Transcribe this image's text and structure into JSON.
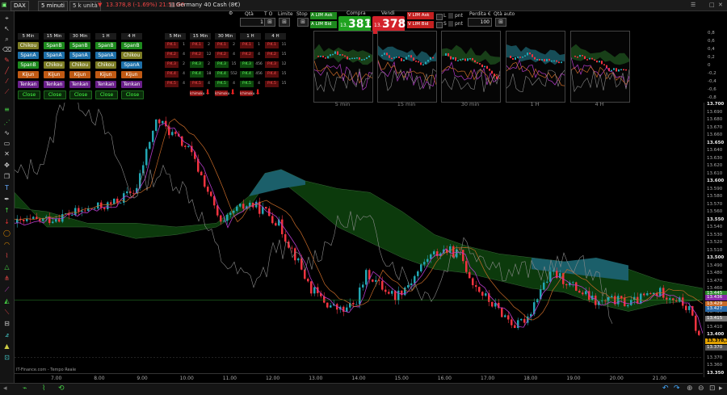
{
  "titlebar": {
    "symbol": "DAX",
    "timeframe": "5 minuti",
    "units": "5 k unità",
    "price_line": "13.378,8 (-1.69%) 21:51:00",
    "instrument": "Germany 40 Cash (8€)"
  },
  "order_panel": {
    "qty_label": "Qtà",
    "qty_value": "1",
    "to_label": "T O",
    "limit_label": "Limite",
    "stop_label": "Stop",
    "buy_label": "Compra",
    "buy_prefix": "13.",
    "buy_big": "381",
    "buy_sup": ",2",
    "sell_label": "Vendi",
    "sell_prefix": "13.",
    "sell_big": "378",
    "sell_sup": ",4",
    "lim_ask_a": "A  LIM Ask",
    "lim_bid_a": "A  LIM Bid",
    "lim_ask_v": "V  LIM Ask",
    "lim_bid_v": "V  LIM Bid",
    "l_label": "L",
    "s_label": "S",
    "pnt_label": "pnt",
    "loss_label": "Perdita €",
    "loss_value": "100",
    "auto_qty": "Qtà auto"
  },
  "ichimoku_grid": {
    "timeframes": [
      "5 Min",
      "15 Min",
      "30 Min",
      "1 H",
      "4 H"
    ],
    "rows": [
      [
        "Chikou",
        "SpanB",
        "SpanB",
        "SpanB",
        "SpanB"
      ],
      [
        "SpanA",
        "SpanA",
        "SpanA",
        "SpanA",
        "Chikou"
      ],
      [
        "SpanB",
        "Chikou",
        "Chikou",
        "Chikou",
        "SpanA"
      ],
      [
        "Kijun",
        "Kijun",
        "Kijun",
        "Kijun",
        "Kijun"
      ],
      [
        "Tenkan",
        "Tenkan",
        "Tenkan",
        "Tenkan",
        "Tenkan"
      ],
      [
        "Close",
        "Close",
        "Close",
        "Close",
        "Close"
      ]
    ],
    "row_colors": [
      [
        "olive",
        "green",
        "green",
        "green",
        "green"
      ],
      [
        "blue",
        "blue",
        "blue",
        "blue",
        "olive"
      ],
      [
        "green",
        "olive",
        "olive",
        "olive",
        "blue"
      ],
      [
        "orange",
        "orange",
        "orange",
        "orange",
        "orange"
      ],
      [
        "purple",
        "purple",
        "purple",
        "purple",
        "purple"
      ],
      [
        "close",
        "close",
        "close",
        "close",
        "close"
      ]
    ]
  },
  "signal_grid": {
    "timeframes": [
      "5 Min",
      "15 Min",
      "30 Min",
      "1 H",
      "4 H"
    ],
    "rows": [
      [
        [
          "P.K.1",
          "1",
          "r"
        ],
        [
          "P.K.1",
          "2",
          "r"
        ],
        [
          "P.K.1",
          "2",
          "r"
        ],
        [
          "P.K.1",
          "1",
          "r"
        ],
        [
          "P.K.1",
          "11",
          "r"
        ]
      ],
      [
        [
          "P.K.2",
          "4",
          "r"
        ],
        [
          "P.K.2",
          "12",
          "r"
        ],
        [
          "P.K.2",
          "4",
          "r"
        ],
        [
          "P.K.2",
          "4",
          "r"
        ],
        [
          "P.K.2",
          "15",
          "r"
        ]
      ],
      [
        [
          "P.K.3",
          "2",
          "r"
        ],
        [
          "P.K.3",
          "2",
          "g"
        ],
        [
          "P.K.3",
          "15",
          "g"
        ],
        [
          "P.K.3",
          "456",
          "g"
        ],
        [
          "P.K.3",
          "12",
          "r"
        ]
      ],
      [
        [
          "P.K.4",
          "4",
          "r"
        ],
        [
          "P.K.4",
          "18",
          "g"
        ],
        [
          "P.K.4",
          "552",
          "g"
        ],
        [
          "P.K.4",
          "456",
          "g"
        ],
        [
          "P.K.4",
          "15",
          "r"
        ]
      ],
      [
        [
          "P.K.5",
          "4",
          "r"
        ],
        [
          "P.K.5",
          "4",
          "r"
        ],
        [
          "P.K.5",
          "4",
          "g"
        ],
        [
          "P.K.5",
          "4",
          "g"
        ],
        [
          "P.K.5",
          "15",
          "r"
        ]
      ]
    ],
    "buttons": [
      "Ichimoku",
      "Ichimoku",
      "Ichimoku"
    ]
  },
  "mini_charts": [
    "5 min",
    "15 min",
    "30 min",
    "1 H",
    "4 H"
  ],
  "mini_axis": [
    "0,8",
    "0,6",
    "0,4",
    "0,2",
    "0",
    "-0,2",
    "-0,4",
    "-0,6",
    "-0,8",
    "-1"
  ],
  "chart": {
    "source": "IT-Finance.com - Tempo Reale",
    "x_labels": [
      "7.00",
      "8.00",
      "9.00",
      "10.00",
      "11.00",
      "12.00",
      "13.00",
      "14.00",
      "15.00",
      "16.00",
      "17.00",
      "18.00",
      "19.00",
      "20.00",
      "21.00"
    ],
    "y_labels": [
      "13.700",
      "13.690",
      "13.680",
      "13.670",
      "13.660",
      "13.650",
      "13.640",
      "13.630",
      "13.620",
      "13.610",
      "13.600",
      "13.590",
      "13.580",
      "13.570",
      "13.560",
      "13.550",
      "13.540",
      "13.530",
      "13.520",
      "13.510",
      "13.500",
      "13.490",
      "13.480",
      "13.470",
      "13.460",
      "13.450",
      "13.440",
      "13.430",
      "13.420",
      "13.410",
      "13.400",
      "13.390",
      "13.380",
      "13.370",
      "13.360",
      "13.350"
    ],
    "last_price": "13.378,3",
    "badges": [
      "13.445",
      "13.436",
      "13.429",
      "13.427",
      "13.415",
      "13.370"
    ],
    "colors": {
      "bull": "#22a6b3",
      "bear": "#f2333f",
      "cloud_green": "#0c3a0c",
      "cloud_cyan": "#1b5f6a",
      "tenkan": "#b43ac8",
      "kijun": "#c86a28",
      "chikou": "#8c8c8c"
    }
  }
}
